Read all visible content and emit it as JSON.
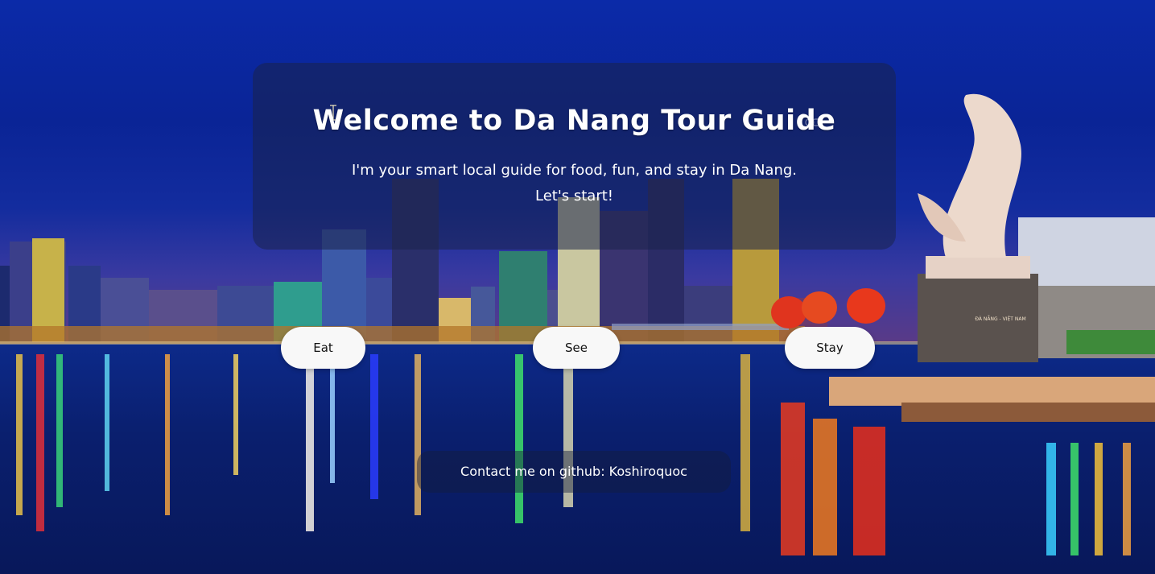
{
  "hero": {
    "title": "Welcome to Da Nang Tour Guide",
    "subtitle_line1": "I'm your smart local guide for food, fun, and stay in Da Nang.",
    "subtitle_line2": "Let's start!"
  },
  "nav": {
    "eat_label": "Eat",
    "see_label": "See",
    "stay_label": "Stay"
  },
  "footer": {
    "contact_text": "Contact me on github: Koshiroquoc"
  },
  "background": {
    "statue_sign": "ĐÀ NẴNG - VIỆT NAM"
  },
  "colors": {
    "sky": "#0b2aa8",
    "water": "#0a1f6e",
    "panel": "#19234b",
    "button": "#f8f8f8"
  }
}
